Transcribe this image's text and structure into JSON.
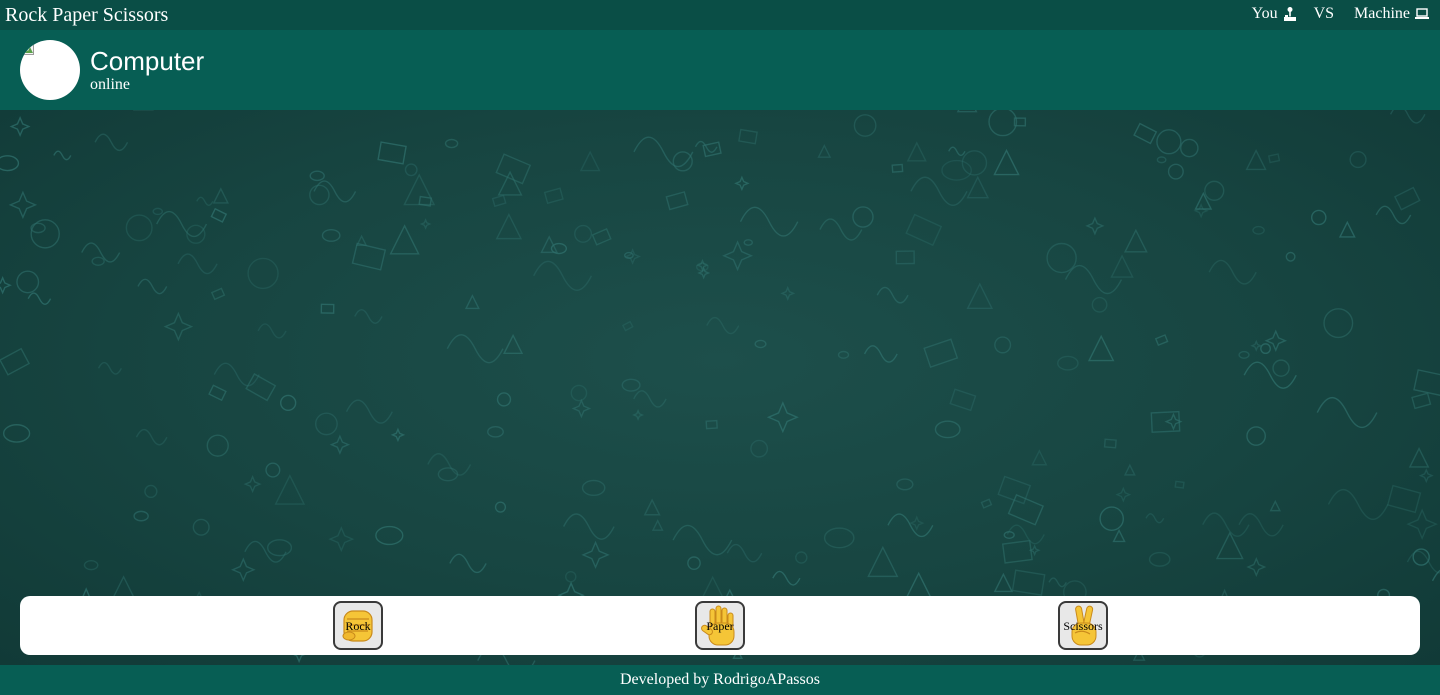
{
  "app": {
    "title": "Rock Paper Scissors"
  },
  "scoreboard": {
    "player_label": "You",
    "player_icon": "joystick-icon",
    "vs_label": "VS",
    "opponent_label": "Machine",
    "opponent_icon": "laptop-icon"
  },
  "contact": {
    "name": "Computer",
    "status": "online",
    "avatar_icon": "broken-image-icon"
  },
  "moves": [
    {
      "label": "Rock",
      "icon": "raised-fist-icon"
    },
    {
      "label": "Paper",
      "icon": "raised-hand-icon"
    },
    {
      "label": "Scissors",
      "icon": "victory-hand-icon"
    }
  ],
  "footer": {
    "credit": "Developed by RodrigoAPassos"
  },
  "colors": {
    "topbar": "#0a4e46",
    "header": "#075e54",
    "footer": "#075e54",
    "wallpaper": "#174541",
    "doodle": "#2e6e6a",
    "emoji_skin": "#f5c537"
  }
}
